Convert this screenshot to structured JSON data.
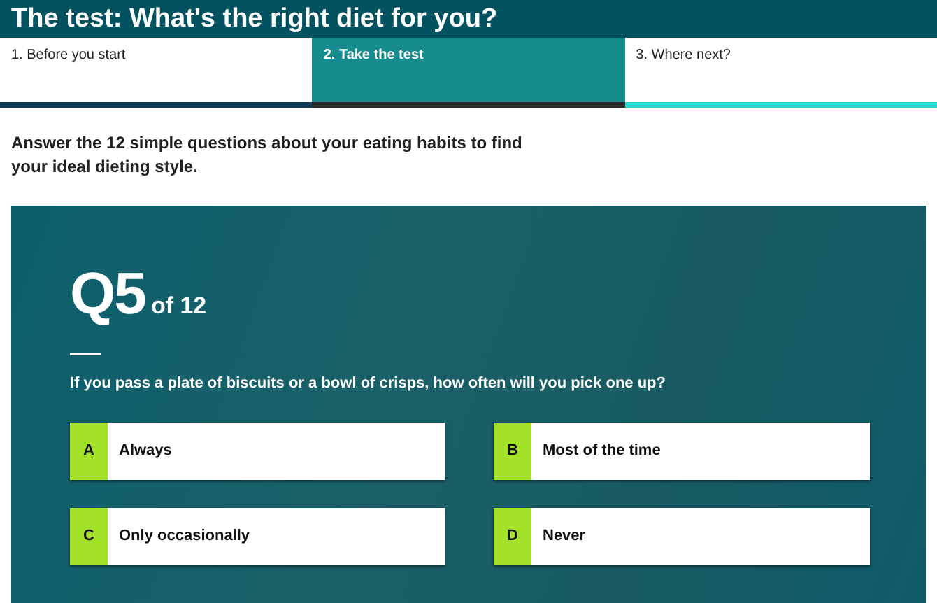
{
  "header": {
    "title": "The test: What's the right diet for you?"
  },
  "tabs": [
    {
      "label": "1. Before you start",
      "selected": false,
      "color": "#0f3a55"
    },
    {
      "label": "2. Take the test",
      "selected": true,
      "color": "#2b2b2b"
    },
    {
      "label": "3. Where next?",
      "selected": false,
      "color": "#24d6cc"
    }
  ],
  "intro": "Answer the 12 simple questions about your eating habits to find your ideal dieting style.",
  "question": {
    "number": "Q5",
    "of": "of 12",
    "text": "If you pass a plate of biscuits or a bowl of crisps, how often will you pick one up?",
    "answers": [
      {
        "letter": "A",
        "label": "Always"
      },
      {
        "letter": "B",
        "label": "Most of the time"
      },
      {
        "letter": "C",
        "label": "Only occasionally"
      },
      {
        "letter": "D",
        "label": "Never"
      }
    ]
  }
}
